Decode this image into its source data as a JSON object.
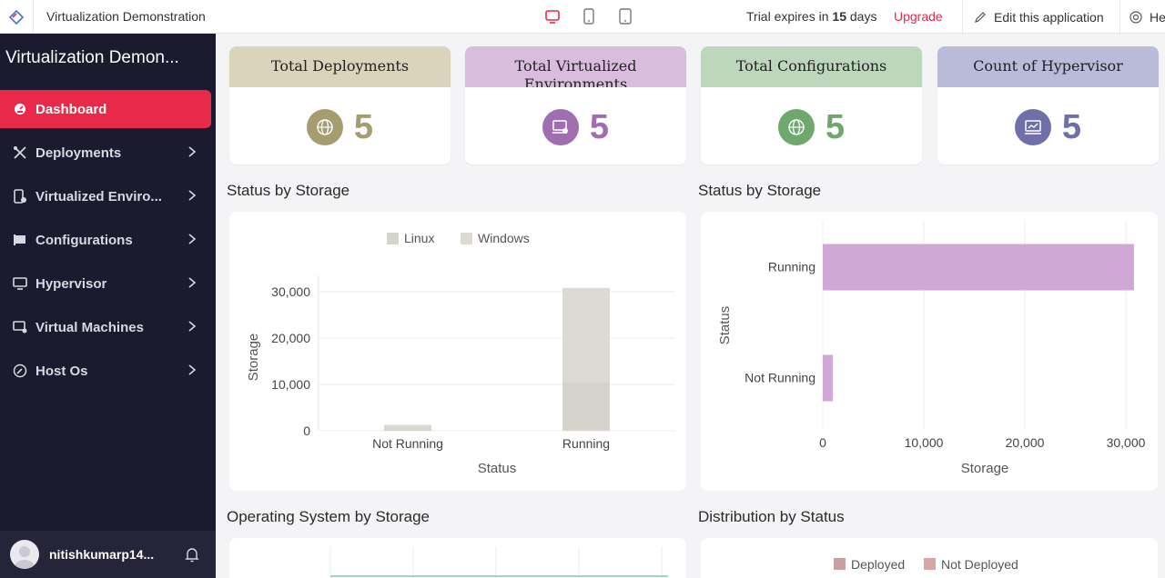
{
  "topbar": {
    "app_title": "Virtualization Demonstration",
    "trial_prefix": "Trial expires in",
    "trial_days": "15",
    "trial_suffix": "days",
    "upgrade": "Upgrade",
    "edit_app": "Edit this application",
    "help": "He",
    "devices": [
      "desktop-icon",
      "tablet-icon",
      "mobile-icon"
    ],
    "accent": "#e8294a"
  },
  "sidebar": {
    "title": "Virtualization Demon...",
    "items": [
      {
        "label": "Dashboard",
        "icon": "dashboard-icon",
        "active": true
      },
      {
        "label": "Deployments",
        "icon": "tools-icon"
      },
      {
        "label": "Virtualized Enviro...",
        "icon": "device-gear-icon"
      },
      {
        "label": "Configurations",
        "icon": "config-icon"
      },
      {
        "label": "Hypervisor",
        "icon": "monitor-icon"
      },
      {
        "label": "Virtual Machines",
        "icon": "monitor-gear-icon"
      },
      {
        "label": "Host Os",
        "icon": "compass-icon"
      }
    ],
    "user": "nitishkumarp14..."
  },
  "cards": [
    {
      "title": "Total Deployments",
      "value": "5",
      "head_color": "#d9d4bb",
      "icon_color": "#a59d70",
      "value_color": "#a59d70",
      "icon": "globe-icon"
    },
    {
      "title": "Total Virtualized Environments",
      "value": "5",
      "head_color": "#d8bddd",
      "icon_color": "#a06daf",
      "value_color": "#a06daf",
      "icon": "laptop-gear-icon"
    },
    {
      "title": "Total Configurations",
      "value": "5",
      "head_color": "#bcd7bb",
      "icon_color": "#6ea86d",
      "value_color": "#6ea86d",
      "icon": "globe-icon"
    },
    {
      "title": "Count of Hypervisor",
      "value": "5",
      "head_color": "#babbd9",
      "icon_color": "#6f6fa9",
      "value_color": "#6f6fa9",
      "icon": "chart-monitor-icon"
    }
  ],
  "sections": {
    "s1": "Status by Storage",
    "s2": "Status by Storage",
    "s3": "Operating System by Storage",
    "s4": "Distribution by Status"
  },
  "chart_data": [
    {
      "type": "bar",
      "title": "Status by Storage",
      "xlabel": "Status",
      "ylabel": "Storage",
      "categories": [
        "Not Running",
        "Running"
      ],
      "series": [
        {
          "name": "Linux",
          "values": [
            500,
            10500
          ],
          "color": "#d6d2cc"
        },
        {
          "name": "Windows",
          "values": [
            800,
            20300
          ],
          "color": "#ddd9d3"
        }
      ],
      "stacked": true,
      "ylim": [
        0,
        30000
      ],
      "yticks": [
        "0",
        "10,000",
        "20,000",
        "30,000"
      ],
      "legend": "top"
    },
    {
      "type": "bar",
      "orientation": "horizontal",
      "title": "Status by Storage",
      "xlabel": "Storage",
      "ylabel": "Status",
      "categories": [
        "Running",
        "Not Running"
      ],
      "values": [
        30800,
        1000
      ],
      "color": "#cfa8d6",
      "xlim": [
        0,
        30000
      ],
      "xticks": [
        "0",
        "10,000",
        "20,000",
        "30,000"
      ]
    },
    {
      "type": "bar",
      "title": "Operating System by Storage"
    },
    {
      "type": "pie",
      "title": "Distribution by Status",
      "series": [
        {
          "name": "Deployed",
          "color": "#c9a0a0"
        },
        {
          "name": "Not Deployed",
          "color": "#d9a6a6"
        }
      ],
      "legend": "top"
    }
  ]
}
